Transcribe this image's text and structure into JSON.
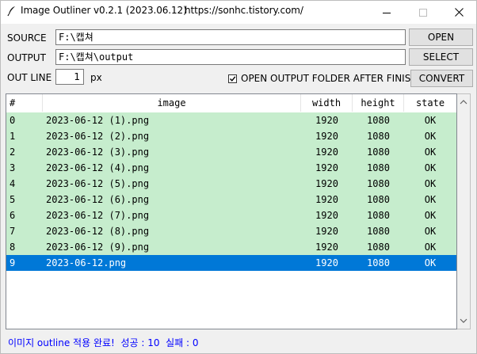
{
  "window": {
    "title": "Image Outliner v0.2.1 (2023.06.12)",
    "url": "https://sonhc.tistory.com/"
  },
  "form": {
    "source_label": "SOURCE",
    "source_value": "F:\\캡쳐",
    "output_label": "OUTPUT",
    "output_value": "F:\\캡쳐\\output",
    "outline_label": "OUT LINE",
    "outline_value": "1",
    "outline_unit": "px",
    "open_folder_label": "OPEN OUTPUT FOLDER AFTER FINISH",
    "open_folder_checked": true,
    "open_button": "OPEN",
    "select_button": "SELECT",
    "convert_button": "CONVERT"
  },
  "table": {
    "columns": [
      "#",
      "image",
      "width",
      "height",
      "state"
    ],
    "rows": [
      {
        "index": "0",
        "image": "2023-06-12 (1).png",
        "width": "1920",
        "height": "1080",
        "state": "OK"
      },
      {
        "index": "1",
        "image": "2023-06-12 (2).png",
        "width": "1920",
        "height": "1080",
        "state": "OK"
      },
      {
        "index": "2",
        "image": "2023-06-12 (3).png",
        "width": "1920",
        "height": "1080",
        "state": "OK"
      },
      {
        "index": "3",
        "image": "2023-06-12 (4).png",
        "width": "1920",
        "height": "1080",
        "state": "OK"
      },
      {
        "index": "4",
        "image": "2023-06-12 (5).png",
        "width": "1920",
        "height": "1080",
        "state": "OK"
      },
      {
        "index": "5",
        "image": "2023-06-12 (6).png",
        "width": "1920",
        "height": "1080",
        "state": "OK"
      },
      {
        "index": "6",
        "image": "2023-06-12 (7).png",
        "width": "1920",
        "height": "1080",
        "state": "OK"
      },
      {
        "index": "7",
        "image": "2023-06-12 (8).png",
        "width": "1920",
        "height": "1080",
        "state": "OK"
      },
      {
        "index": "8",
        "image": "2023-06-12 (9).png",
        "width": "1920",
        "height": "1080",
        "state": "OK"
      },
      {
        "index": "9",
        "image": "2023-06-12.png",
        "width": "1920",
        "height": "1080",
        "state": "OK"
      }
    ],
    "selected_index": 9
  },
  "status": {
    "text": "이미지 outline 적용 완료!  성공 : 10  실패 : 0"
  },
  "colors": {
    "row_ok": "#c6edcd",
    "row_selected": "#0078d7",
    "status_text": "#0000ff"
  },
  "icons": {
    "app": "feather-pen-icon",
    "minimize": "minimize-icon",
    "maximize": "maximize-icon",
    "close": "close-icon",
    "checkbox": "checkmark-icon"
  }
}
